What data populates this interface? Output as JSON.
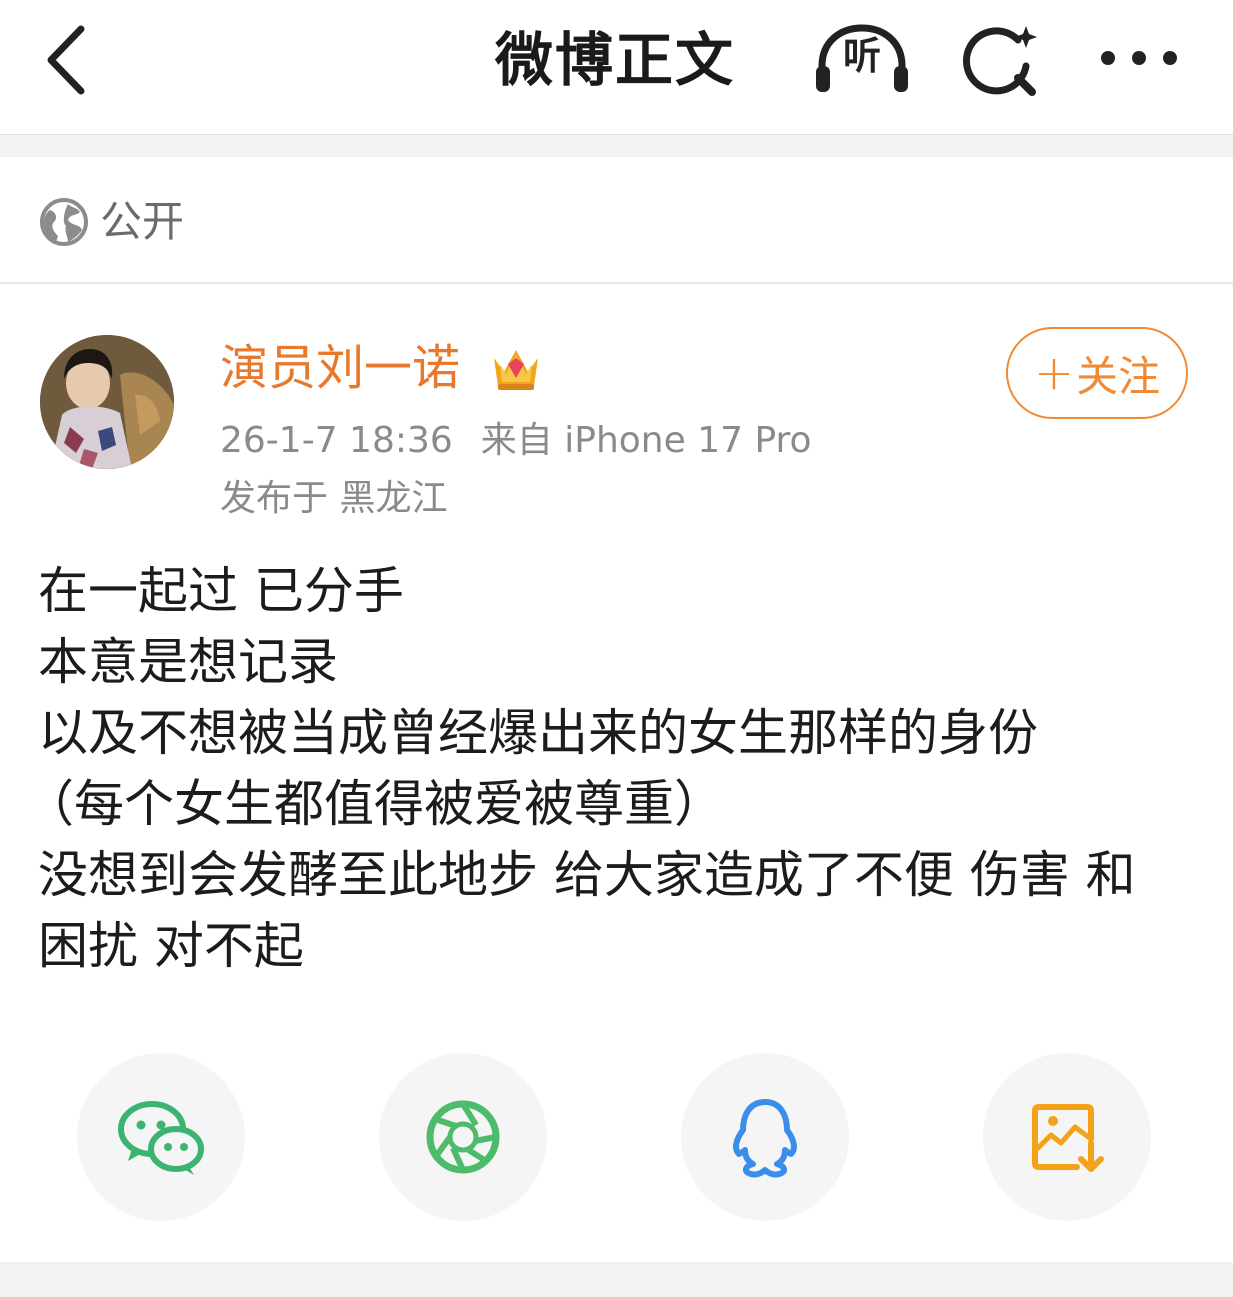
{
  "header": {
    "title": "微博正文",
    "listen_label": "听"
  },
  "visibility": {
    "label": "公开"
  },
  "author": {
    "name": "演员刘一诺",
    "follow_label": "关注",
    "follow_plus": "+",
    "time": "26-1-7 18:36",
    "source": "来自 iPhone 17 Pro",
    "location": "发布于 黑龙江"
  },
  "post": {
    "lines": [
      "在一起过 已分手",
      "本意是想记录",
      "以及不想被当成曾经爆出来的女生那样的身份",
      "（每个女生都值得被爱被尊重）",
      "没想到会发酵至此地步 给大家造成了不便 伤害 和",
      "困扰 对不起"
    ]
  },
  "share": {
    "items": [
      {
        "icon": "wechat-icon"
      },
      {
        "icon": "moments-icon"
      },
      {
        "icon": "qq-icon"
      },
      {
        "icon": "save-image-icon"
      }
    ]
  },
  "colors": {
    "accent": "#f08a35",
    "author_name": "#e8792c",
    "meta": "#8a8a8a",
    "wechat": "#3cb371",
    "moments": "#4cbb6a",
    "qq": "#3a8de8",
    "save": "#f3a21a"
  }
}
